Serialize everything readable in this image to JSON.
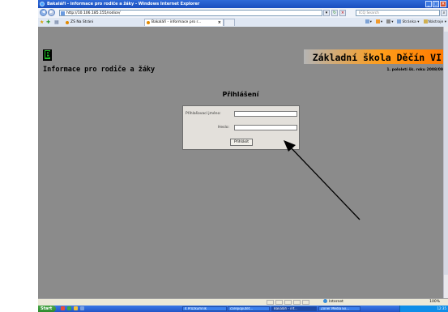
{
  "window": {
    "title": "Bakaláři - informace pro rodiče a žáky - Windows Internet Explorer"
  },
  "address_bar": {
    "url": "http://10.106.185.155/rodice/",
    "search_placeholder": "ICQ Search"
  },
  "favorites": {
    "item": "ZŠ Na Stráni"
  },
  "tabs": [
    {
      "label": "Bakaláři - informace pro r...",
      "active": true
    }
  ],
  "command_bar": {
    "page_label": "Stránka",
    "tools_label": "Nástroje"
  },
  "page": {
    "logo_letter": "B",
    "subtitle": "Informace pro rodiče a žáky",
    "school_name": "Základní škola Děčín VI",
    "school_year": "1. pololetí šk. roku 2008/09",
    "login_heading": "Přihlášení",
    "login": {
      "username_label": "Přihlašovací jméno:",
      "username_value": "",
      "password_label": "Heslo:",
      "password_value": "",
      "submit_label": "Přihlásit"
    }
  },
  "status_bar": {
    "zone": "Internet",
    "zoom": "100%"
  },
  "taskbar": {
    "start_label": "Start",
    "buttons": [
      "4 Průzkumník",
      "carepoputet...",
      "Bakaláři - inf...",
      "Zoner Media Ex..."
    ],
    "clock": "12:35"
  },
  "colors": {
    "titlebar": "#2f6ad8",
    "content_bg": "#8b8b8b",
    "school_banner_accent": "#ff8c00",
    "logo_green": "#23c22a"
  }
}
